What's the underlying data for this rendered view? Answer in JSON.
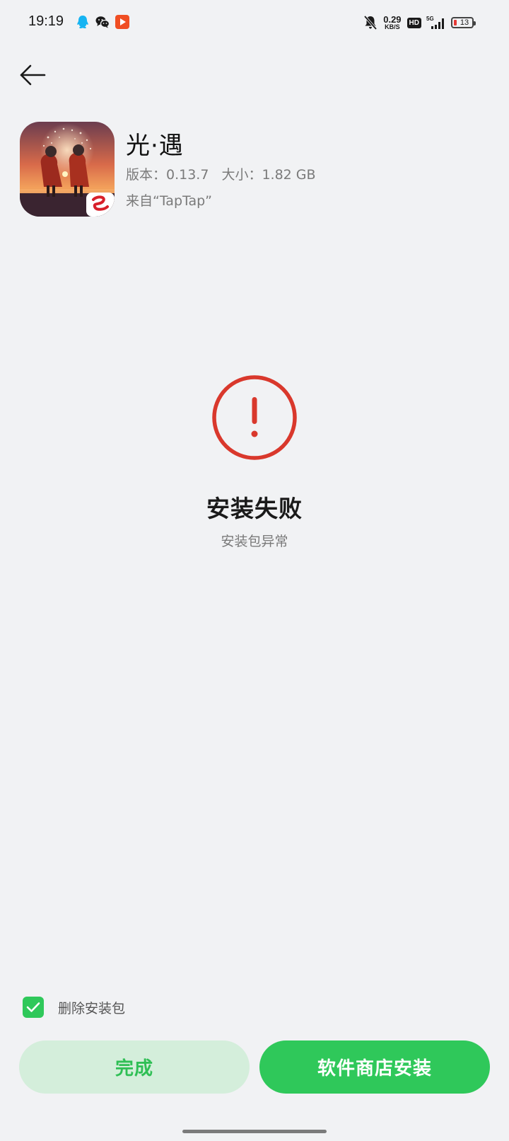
{
  "status_bar": {
    "time": "19:19",
    "notification_icons": [
      "qq-icon",
      "wechat-icon",
      "video-app-icon"
    ],
    "net_speed_value": "0.29",
    "net_speed_unit": "KB/S",
    "hd_label": "HD",
    "network_type": "5G",
    "battery_level": "13",
    "battery_color": "#e53935"
  },
  "app": {
    "name": "光·遇",
    "version_label": "版本：0.13.7",
    "size_label": "大小：1.82 GB",
    "source": "来自“TapTap”"
  },
  "result": {
    "title": "安装失败",
    "subtitle": "安装包异常",
    "icon": "error-exclamation-icon",
    "icon_color": "#d9382c"
  },
  "options": {
    "delete_package_label": "删除安装包",
    "delete_package_checked": true
  },
  "buttons": {
    "done_label": "完成",
    "store_install_label": "软件商店安装"
  },
  "colors": {
    "accent": "#2fc85a",
    "background": "#f1f2f4"
  }
}
